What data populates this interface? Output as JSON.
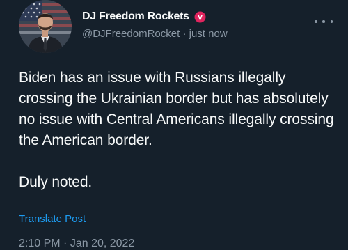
{
  "author": {
    "display_name": "DJ Freedom Rockets",
    "handle": "@DJFreedomRocket",
    "separator": "·",
    "posted_relative": "just now",
    "badge_letter": "V",
    "badge_color": "#e0245e"
  },
  "tweet": {
    "paragraphs": [
      "Biden has an issue with Russians illegally crossing the Ukrainian border but has absolutely no issue with Central Americans illegally crossing the American border.",
      "Duly noted."
    ]
  },
  "actions": {
    "translate_label": "Translate Post"
  },
  "meta": {
    "time": "2:10 PM",
    "separator": "·",
    "date": "Jan 20, 2022"
  },
  "colors": {
    "background": "#15202b",
    "text_primary": "#f7f9f9",
    "text_secondary": "#8b98a5",
    "link": "#1d9bf0"
  },
  "icons": {
    "more": "more-horizontal-icon",
    "badge": "verified-badge-icon",
    "avatar": "profile-avatar"
  }
}
